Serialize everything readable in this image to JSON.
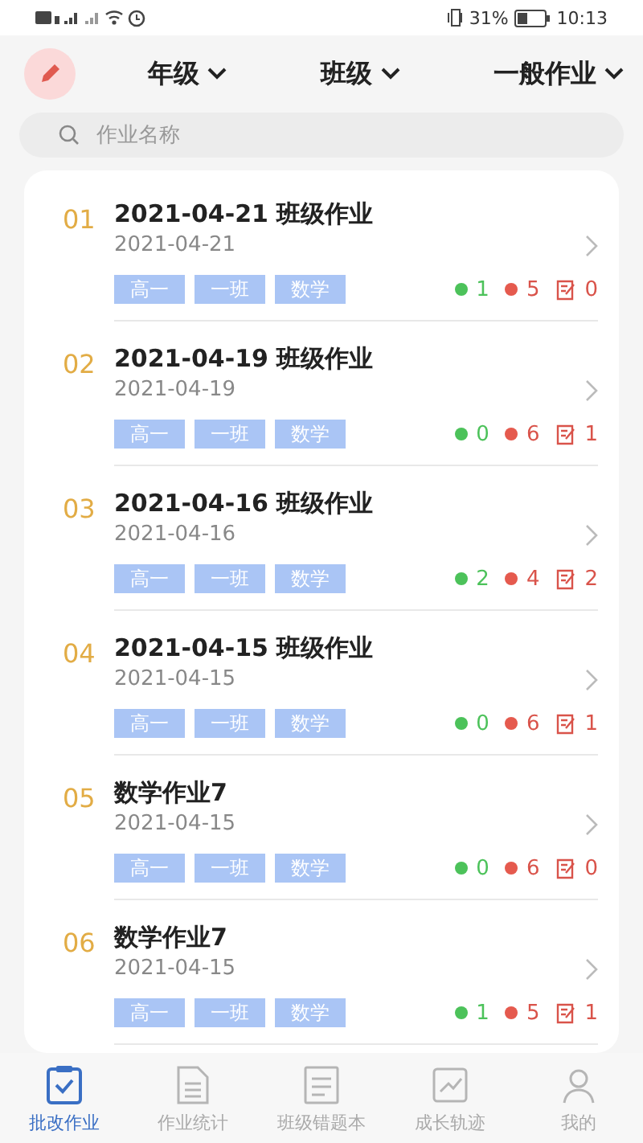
{
  "status_bar": {
    "battery": "31%",
    "time": "10:13"
  },
  "filters": [
    {
      "label": "年级"
    },
    {
      "label": "班级"
    },
    {
      "label": "一般作业"
    }
  ],
  "search": {
    "placeholder": "作业名称"
  },
  "assignments": [
    {
      "index": "01",
      "title": "2021-04-21 班级作业",
      "date": "2021-04-21",
      "tags": [
        "高一",
        "一班",
        "数学"
      ],
      "stats": [
        {
          "kind": "correct",
          "value": "1"
        },
        {
          "kind": "wrong",
          "value": "5"
        },
        {
          "kind": "unmarked",
          "value": "0"
        }
      ]
    },
    {
      "index": "02",
      "title": "2021-04-19 班级作业",
      "date": "2021-04-19",
      "tags": [
        "高一",
        "一班",
        "数学"
      ],
      "stats": [
        {
          "kind": "correct",
          "value": "0"
        },
        {
          "kind": "wrong",
          "value": "6"
        },
        {
          "kind": "unmarked",
          "value": "1"
        }
      ]
    },
    {
      "index": "03",
      "title": "2021-04-16 班级作业",
      "date": "2021-04-16",
      "tags": [
        "高一",
        "一班",
        "数学"
      ],
      "stats": [
        {
          "kind": "correct",
          "value": "2"
        },
        {
          "kind": "wrong",
          "value": "4"
        },
        {
          "kind": "unmarked",
          "value": "2"
        }
      ]
    },
    {
      "index": "04",
      "title": "2021-04-15 班级作业",
      "date": "2021-04-15",
      "tags": [
        "高一",
        "一班",
        "数学"
      ],
      "stats": [
        {
          "kind": "correct",
          "value": "0"
        },
        {
          "kind": "wrong",
          "value": "6"
        },
        {
          "kind": "unmarked",
          "value": "1"
        }
      ]
    },
    {
      "index": "05",
      "title": "数学作业7",
      "date": "2021-04-15",
      "tags": [
        "高一",
        "一班",
        "数学"
      ],
      "stats": [
        {
          "kind": "correct",
          "value": "0"
        },
        {
          "kind": "wrong",
          "value": "6"
        },
        {
          "kind": "unmarked",
          "value": "0"
        }
      ]
    },
    {
      "index": "06",
      "title": "数学作业7",
      "date": "2021-04-15",
      "tags": [
        "高一",
        "一班",
        "数学"
      ],
      "stats": [
        {
          "kind": "correct",
          "value": "1"
        },
        {
          "kind": "wrong",
          "value": "5"
        },
        {
          "kind": "unmarked",
          "value": "1"
        }
      ]
    }
  ],
  "bottom_nav": [
    {
      "kind": "grading",
      "label": "批改作业",
      "selected": true
    },
    {
      "kind": "stats",
      "label": "作业统计",
      "selected": false
    },
    {
      "kind": "mistakes",
      "label": "班级错题本",
      "selected": false
    },
    {
      "kind": "growth",
      "label": "成长轨迹",
      "selected": false
    },
    {
      "kind": "me",
      "label": "我的",
      "selected": false
    }
  ]
}
